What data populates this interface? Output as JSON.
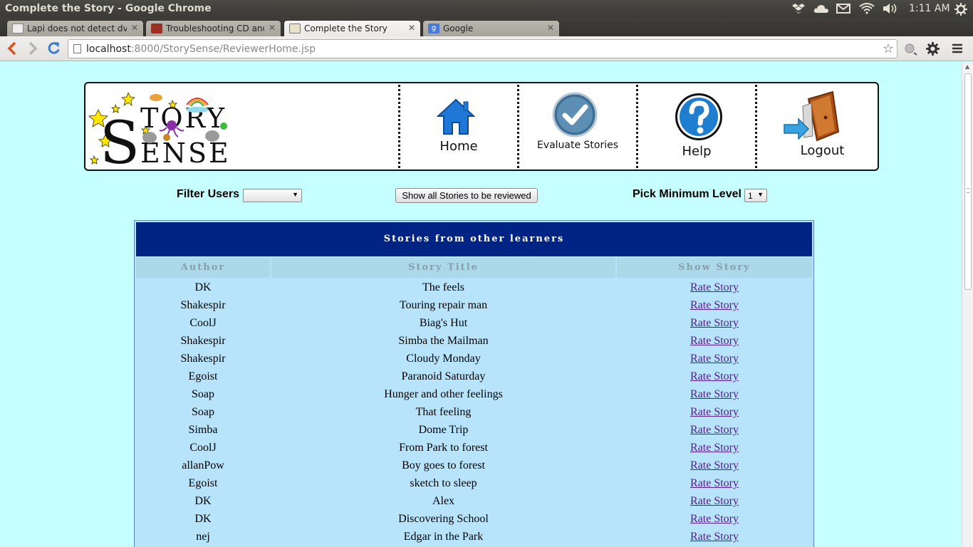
{
  "window": {
    "title": "Complete the Story - Google Chrome",
    "clock": "1:11 AM"
  },
  "tabs": [
    {
      "label": "Lapi does not detect dvd",
      "active": false
    },
    {
      "label": "Troubleshooting CD and I",
      "active": false
    },
    {
      "label": "Complete the Story",
      "active": true
    },
    {
      "label": "Google",
      "active": false
    }
  ],
  "toolbar": {
    "url_host": "localhost",
    "url_rest": ":8000/StorySense/ReviewerHome.jsp"
  },
  "header": {
    "logo": "StorySense",
    "nav": [
      {
        "label": "Home"
      },
      {
        "label": "Evaluate Stories"
      },
      {
        "label": "Help"
      },
      {
        "label": "Logout"
      }
    ]
  },
  "filters": {
    "filter_users_label": "Filter Users",
    "filter_users_value": "",
    "show_all_label": "Show all Stories to be reviewed",
    "min_level_label": "Pick Minimum Level",
    "min_level_value": "1"
  },
  "table": {
    "caption": "Stories from other learners",
    "columns": [
      "Author",
      "Story Title",
      "Show Story"
    ],
    "rows": [
      {
        "author": "DK",
        "title": "The feels",
        "action": "Rate Story"
      },
      {
        "author": "Shakespir",
        "title": "Touring repair man",
        "action": "Rate Story"
      },
      {
        "author": "CoolJ",
        "title": "Biag's Hut",
        "action": "Rate Story"
      },
      {
        "author": "Shakespir",
        "title": "Simba the Mailman",
        "action": "Rate Story"
      },
      {
        "author": "Shakespir",
        "title": "Cloudy Monday",
        "action": "Rate Story"
      },
      {
        "author": "Egoist",
        "title": "Paranoid Saturday",
        "action": "Rate Story"
      },
      {
        "author": "Soap",
        "title": "Hunger and other feelings",
        "action": "Rate Story"
      },
      {
        "author": "Soap",
        "title": "That feeling",
        "action": "Rate Story"
      },
      {
        "author": "Simba",
        "title": "Dome Trip",
        "action": "Rate Story"
      },
      {
        "author": "CoolJ",
        "title": "From Park to forest",
        "action": "Rate Story"
      },
      {
        "author": "allanPow",
        "title": "Boy goes to forest",
        "action": "Rate Story"
      },
      {
        "author": "Egoist",
        "title": "sketch to sleep",
        "action": "Rate Story"
      },
      {
        "author": "DK",
        "title": "Alex",
        "action": "Rate Story"
      },
      {
        "author": "DK",
        "title": "Discovering School",
        "action": "Rate Story"
      },
      {
        "author": "nej",
        "title": "Edgar in the Park",
        "action": "Rate Story"
      }
    ]
  },
  "colors": {
    "page_bg": "#c6ffff",
    "caption_bg": "#002484",
    "header_row_bg": "#acd9ea",
    "table_bg": "#b7e4fb",
    "link": "#551a8b"
  }
}
